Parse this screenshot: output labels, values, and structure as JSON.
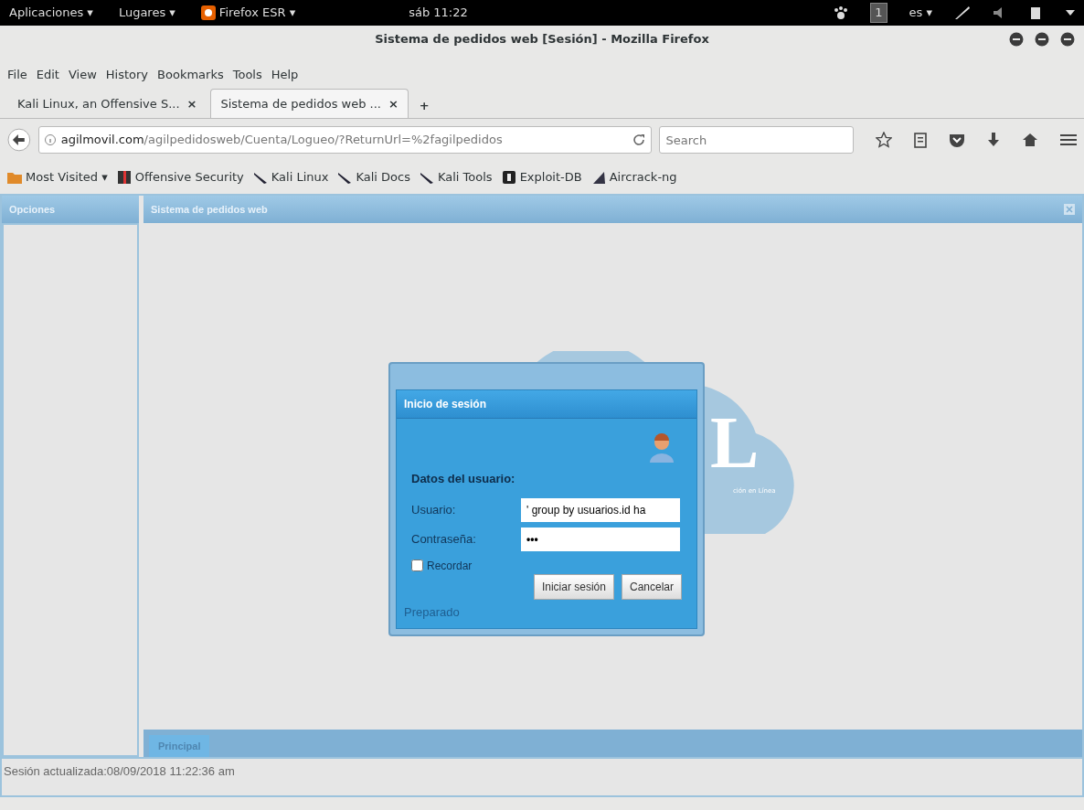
{
  "top_bar": {
    "apps": "Aplicaciones ▾",
    "places": "Lugares ▾",
    "active_app": "Firefox ESR ▾",
    "clock": "sáb 11:22",
    "workspace": "1",
    "language": "es ▾"
  },
  "window": {
    "title": "Sistema de pedidos web [Sesión] - Mozilla Firefox"
  },
  "menu": [
    "File",
    "Edit",
    "View",
    "History",
    "Bookmarks",
    "Tools",
    "Help"
  ],
  "tabs": [
    {
      "label": "Kali Linux, an Offensive S...",
      "close": "×",
      "selected": false
    },
    {
      "label": "Sistema de pedidos web ...",
      "close": "×",
      "selected": true
    }
  ],
  "new_tab": "+",
  "url": {
    "host": "agilmovil.com",
    "path": "/agilpedidosweb/Cuenta/Logueo/?ReturnUrl=%2fagilpedidos"
  },
  "search": {
    "placeholder": "Search"
  },
  "bookmarks": [
    {
      "label": "Most Visited ▾",
      "kind": "folder"
    },
    {
      "label": "Offensive Security",
      "kind": "offsec"
    },
    {
      "label": "Kali Linux",
      "kind": "kali"
    },
    {
      "label": "Kali Docs",
      "kind": "kali"
    },
    {
      "label": "Kali Tools",
      "kind": "kali"
    },
    {
      "label": "Exploit-DB",
      "kind": "exploit"
    },
    {
      "label": "Aircrack-ng",
      "kind": "air"
    }
  ],
  "app": {
    "sidebar_title": "Opciones",
    "panel_title": "Sistema de pedidos web",
    "logo_letter": "L",
    "logo_tagline": "ción en Línea",
    "bottom_tabs": [
      {
        "label": "Principal",
        "selected": true
      }
    ],
    "status": "Sesión actualizada:08/09/2018 11:22:36 am"
  },
  "dialog": {
    "title": "Inicio de sesión",
    "section": "Datos del usuario:",
    "fields": [
      {
        "label": "Usuario:",
        "value": "' group by usuarios.id ha",
        "kind": "text"
      },
      {
        "label": "Contraseña:",
        "value": "•••",
        "kind": "password"
      }
    ],
    "remember": {
      "label": "Recordar",
      "checked": false
    },
    "buttons": [
      "Iniciar sesión",
      "Cancelar"
    ],
    "status": "Preparado"
  }
}
